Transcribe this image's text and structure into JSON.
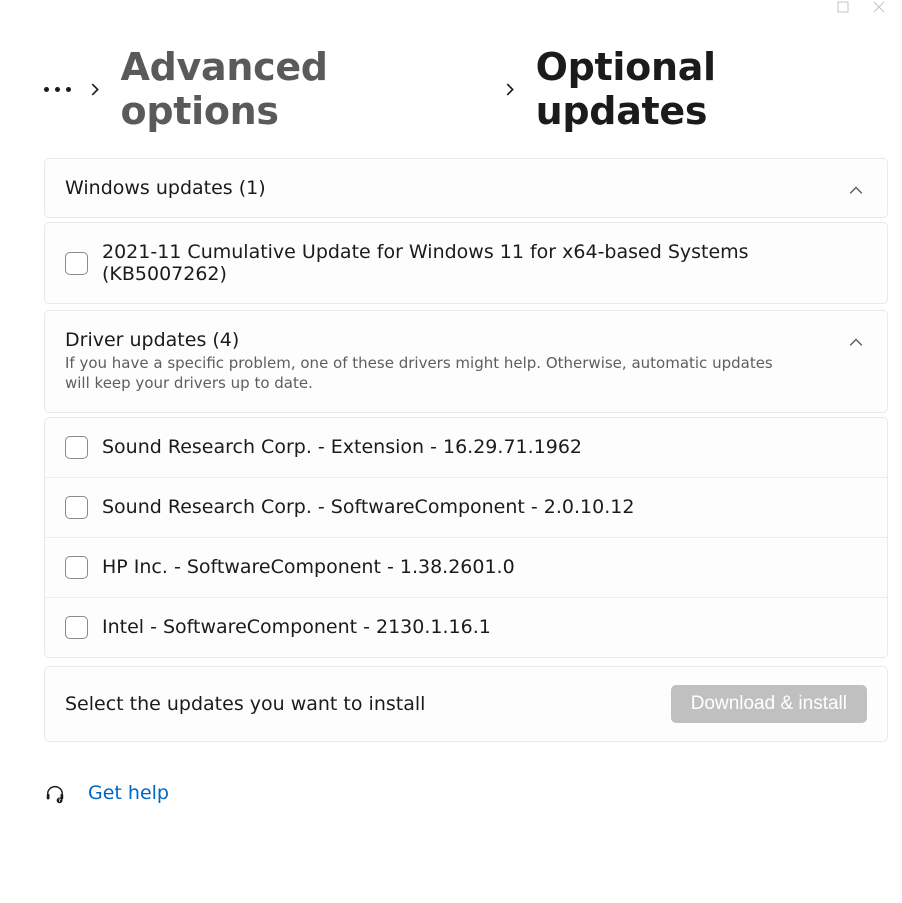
{
  "breadcrumb": {
    "link": "Advanced options",
    "current": "Optional updates"
  },
  "groups": {
    "windows": {
      "title": "Windows updates (1)",
      "items": [
        {
          "label": "2021-11 Cumulative Update for Windows 11 for x64-based Systems (KB5007262)"
        }
      ]
    },
    "drivers": {
      "title": "Driver updates (4)",
      "subtitle": "If you have a specific problem, one of these drivers might help. Otherwise, automatic updates will keep your drivers up to date.",
      "items": [
        {
          "label": "Sound Research Corp. - Extension - 16.29.71.1962"
        },
        {
          "label": "Sound Research Corp. - SoftwareComponent - 2.0.10.12"
        },
        {
          "label": "HP Inc. - SoftwareComponent - 1.38.2601.0"
        },
        {
          "label": "Intel - SoftwareComponent - 2130.1.16.1"
        }
      ]
    }
  },
  "footer": {
    "hint": "Select the updates you want to install",
    "button": "Download & install"
  },
  "help": {
    "link": "Get help"
  }
}
